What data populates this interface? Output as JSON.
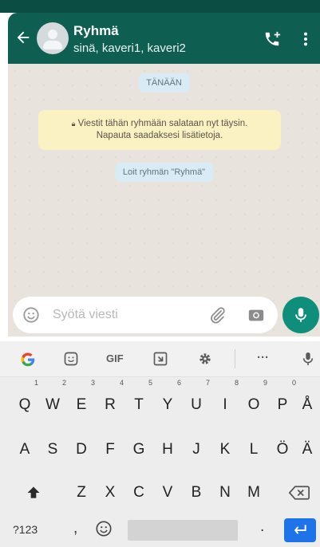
{
  "header": {
    "title": "Ryhmä",
    "subtitle": "sinä, kaveri1, kaveri2",
    "icons": [
      "back-arrow-icon",
      "group-avatar-icon",
      "add-call-icon",
      "more-vert-icon"
    ]
  },
  "chat": {
    "date_label": "TÄNÄÄN",
    "encryption_line1": "Viestit tähän ryhmään salataan nyt täysin.",
    "encryption_line2": "Napauta saadaksesi lisätietoja.",
    "created_label": "Loit ryhmän \"Ryhmä\""
  },
  "input": {
    "placeholder": "Syötä viesti",
    "icons": [
      "emoji-icon",
      "attach-icon",
      "camera-icon",
      "mic-icon"
    ]
  },
  "keyboard": {
    "toolbar": {
      "gif_label": "GIF",
      "more_label": "···",
      "icons": [
        "google-icon",
        "sticker-icon",
        "gif-icon",
        "translate-icon",
        "settings-icon",
        "more-icon",
        "mic-icon"
      ]
    },
    "row1": [
      {
        "key": "Q",
        "hint": "1"
      },
      {
        "key": "W",
        "hint": "2"
      },
      {
        "key": "E",
        "hint": "3"
      },
      {
        "key": "R",
        "hint": "4"
      },
      {
        "key": "T",
        "hint": "5"
      },
      {
        "key": "Y",
        "hint": "6"
      },
      {
        "key": "U",
        "hint": "7"
      },
      {
        "key": "I",
        "hint": "8"
      },
      {
        "key": "O",
        "hint": "9"
      },
      {
        "key": "P",
        "hint": "0"
      },
      {
        "key": "Å",
        "hint": ""
      }
    ],
    "row2": [
      "A",
      "S",
      "D",
      "F",
      "G",
      "H",
      "J",
      "K",
      "L",
      "Ö",
      "Ä"
    ],
    "row3": [
      "Z",
      "X",
      "C",
      "V",
      "B",
      "N",
      "M"
    ],
    "row4": {
      "symbols": "?123",
      "comma": ",",
      "period": "."
    },
    "colors": {
      "enter": "#1f73e8",
      "header": "#0f5e52",
      "mic": "#0f8f7b"
    }
  }
}
